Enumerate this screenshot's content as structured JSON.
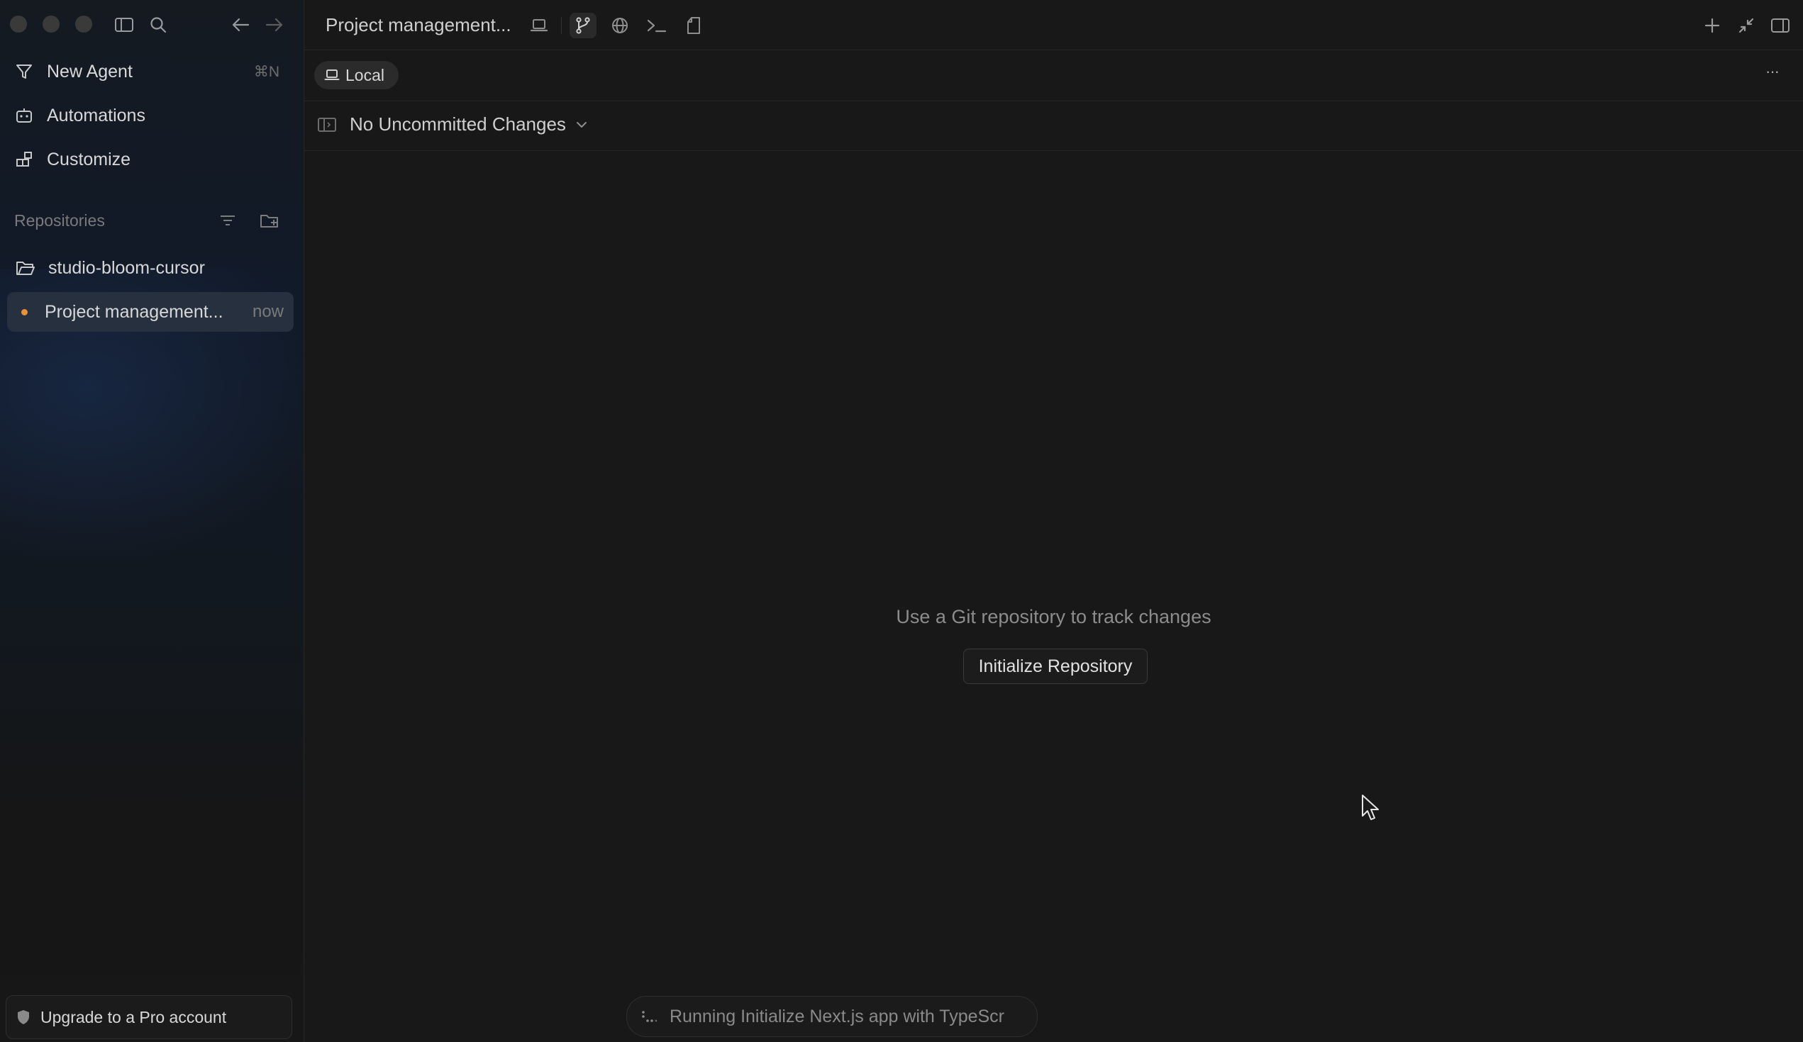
{
  "sidebar": {
    "new_agent": {
      "label": "New Agent",
      "shortcut": "⌘N"
    },
    "automations": "Automations",
    "customize": "Customize",
    "repositories_label": "Repositories",
    "repos": [
      {
        "name": "studio-bloom-cursor",
        "icon": "folder-open-icon"
      },
      {
        "name": "Project management...",
        "time": "now",
        "status_color": "#e8913a"
      }
    ],
    "upgrade": "Upgrade to a Pro account"
  },
  "header": {
    "title": "Project management...",
    "icons": [
      "laptop-icon",
      "git-branch-icon",
      "globe-icon",
      "terminal-icon",
      "document-icon",
      "plus-icon",
      "collapse-icon",
      "sidebar-right-icon"
    ]
  },
  "toolbar": {
    "environment_chip": "Local",
    "more": "···"
  },
  "changes": {
    "label": "No Uncommitted Changes"
  },
  "empty_state": {
    "message": "Use a Git repository to track changes",
    "button": "Initialize Repository"
  },
  "status": {
    "text": "Running Initialize Next.js app with TypeScr"
  },
  "colors": {
    "background": "#181818",
    "sidebar": "#121820",
    "accent_dot": "#e8913a",
    "active_row": "#26303f"
  }
}
